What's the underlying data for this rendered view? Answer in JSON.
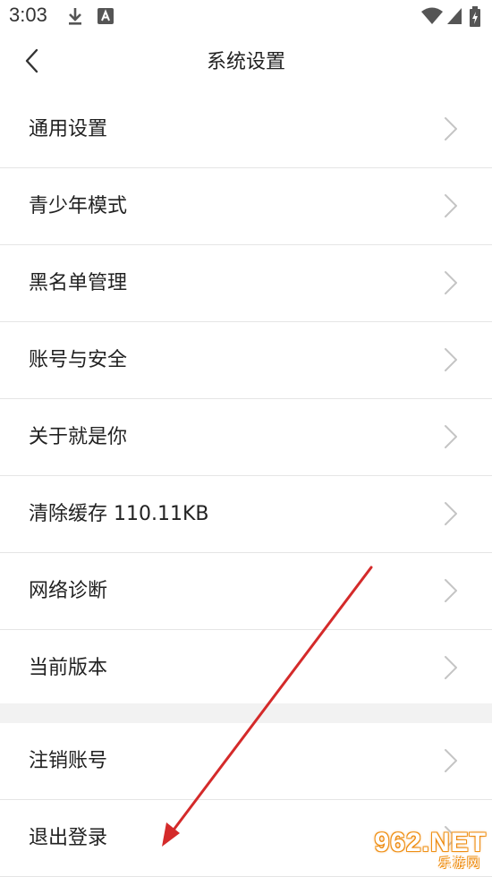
{
  "status_bar": {
    "time": "3:03",
    "icons": [
      "download-icon",
      "a-notification-icon",
      "wifi-icon",
      "signal-icon",
      "battery-charging-icon"
    ]
  },
  "header": {
    "title": "系统设置",
    "back_icon": "chevron-left-icon"
  },
  "settings": {
    "group1": [
      {
        "label": "通用设置"
      },
      {
        "label": "青少年模式"
      },
      {
        "label": "黑名单管理"
      },
      {
        "label": "账号与安全"
      },
      {
        "label": "关于就是你"
      },
      {
        "label": "清除缓存 110.11KB"
      },
      {
        "label": "网络诊断"
      },
      {
        "label": "当前版本"
      }
    ],
    "group2": [
      {
        "label": "注销账号"
      },
      {
        "label": "退出登录"
      }
    ]
  },
  "annotation": {
    "arrow_color": "#d42a2a"
  },
  "watermark": {
    "main": "962.NET",
    "sub": "乐游网"
  }
}
